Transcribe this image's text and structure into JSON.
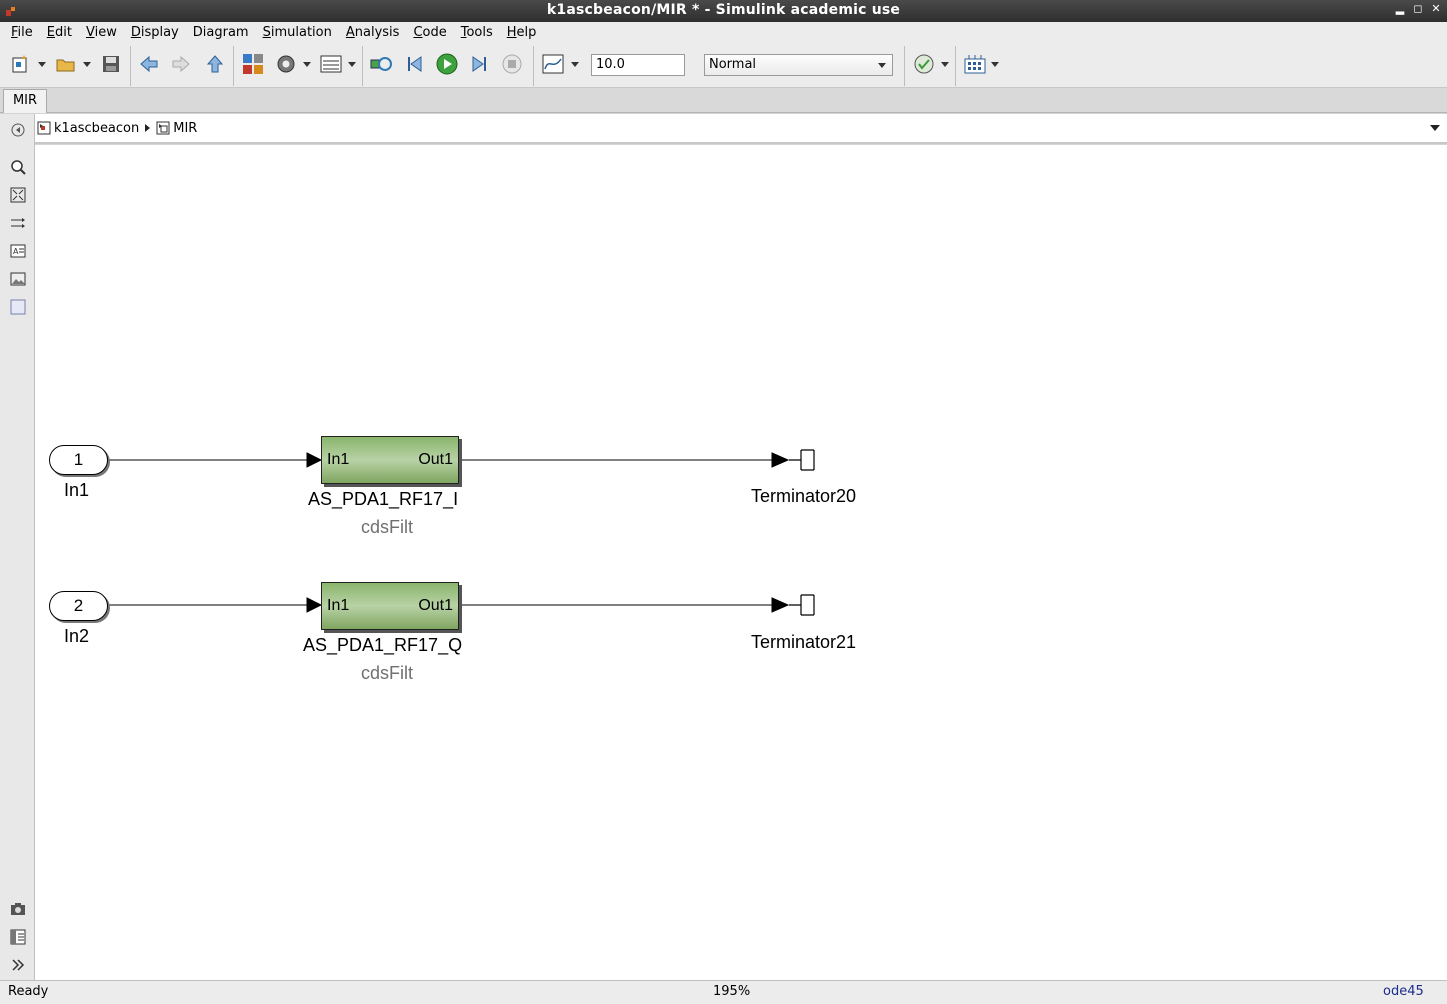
{
  "window": {
    "title": "k1ascbeacon/MIR * - Simulink academic use"
  },
  "menu": [
    {
      "label": "File",
      "u": "F",
      "rest": "ile"
    },
    {
      "label": "Edit",
      "u": "E",
      "rest": "dit"
    },
    {
      "label": "View",
      "u": "V",
      "rest": "iew"
    },
    {
      "label": "Display",
      "u": "D",
      "rest": "isplay"
    },
    {
      "label": "Diagram",
      "u": "",
      "rest": "Diagram"
    },
    {
      "label": "Simulation",
      "u": "S",
      "rest": "imulation"
    },
    {
      "label": "Analysis",
      "u": "A",
      "rest": "nalysis"
    },
    {
      "label": "Code",
      "u": "C",
      "rest": "ode"
    },
    {
      "label": "Tools",
      "u": "T",
      "rest": "ools"
    },
    {
      "label": "Help",
      "u": "H",
      "rest": "elp"
    }
  ],
  "toolbar": {
    "stop_time": "10.0",
    "sim_mode": "Normal"
  },
  "tabs": [
    {
      "label": "MIR"
    }
  ],
  "breadcrumb": [
    "k1ascbeacon",
    "MIR"
  ],
  "diagram": {
    "inports": [
      {
        "number": "1",
        "name": "In1"
      },
      {
        "number": "2",
        "name": "In2"
      }
    ],
    "subsystems": [
      {
        "in_port": "In1",
        "out_port": "Out1",
        "name": "AS_PDA1_RF17_I",
        "tag": "cdsFilt"
      },
      {
        "in_port": "In1",
        "out_port": "Out1",
        "name": "AS_PDA1_RF17_Q",
        "tag": "cdsFilt"
      }
    ],
    "terminators": [
      {
        "name": "Terminator20"
      },
      {
        "name": "Terminator21"
      }
    ]
  },
  "status": {
    "state": "Ready",
    "zoom": "195%",
    "solver": "ode45"
  },
  "colors": {
    "subsystem_fill": "#a3c48c",
    "canvas": "#ffffff",
    "titlebar": "#3a3a3a"
  },
  "icons": {
    "toolbar": [
      "new-model-icon",
      "open-icon",
      "save-icon",
      "back-icon",
      "forward-icon",
      "up-icon",
      "library-browser-icon",
      "model-config-icon",
      "model-explorer-icon",
      "update-diagram-icon",
      "step-back-icon",
      "run-icon",
      "step-forward-icon",
      "stop-icon",
      "scope-icon",
      "model-advisor-icon",
      "build-icon"
    ],
    "palette": [
      "hide-explorer-icon",
      "zoom-icon",
      "fit-view-icon",
      "arrow-lines-icon",
      "annotation-icon",
      "image-icon",
      "area-icon",
      "screenshot-icon",
      "model-browser-icon",
      "expand-icon"
    ]
  }
}
